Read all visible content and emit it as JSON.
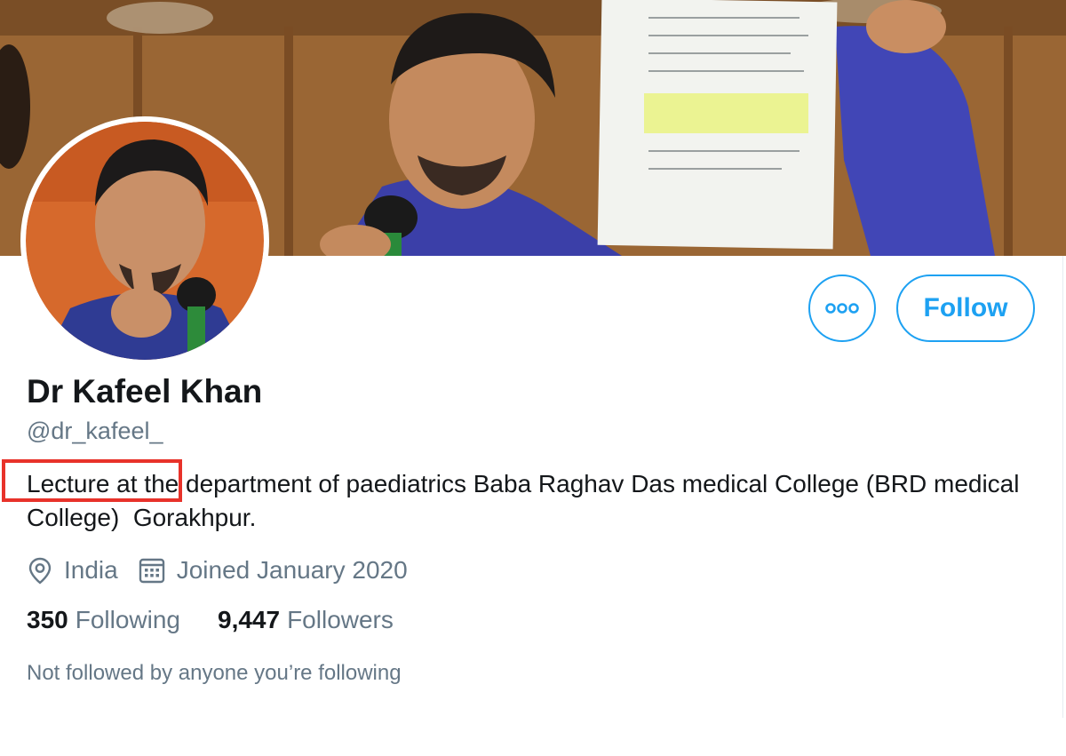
{
  "profile": {
    "name": "Dr Kafeel Khan",
    "handle": "@dr_kafeel_",
    "bio": "Lecture at the department of paediatrics Baba Raghav Das medical College (BRD medical College)  Gorakhpur.",
    "location": "India",
    "joined": "Joined January 2020"
  },
  "stats": {
    "following_count": "350",
    "following_label": "Following",
    "followers_count": "9,447",
    "followers_label": "Followers"
  },
  "actions": {
    "follow_label": "Follow"
  },
  "footer": {
    "not_followed": "Not followed by anyone you’re following"
  },
  "icons": {
    "more": "more-options-icon",
    "location": "location-pin-icon",
    "calendar": "calendar-icon"
  },
  "colors": {
    "accent": "#1da1f2",
    "text_primary": "#14171a",
    "text_secondary": "#657786",
    "highlight": "#e8322a"
  }
}
